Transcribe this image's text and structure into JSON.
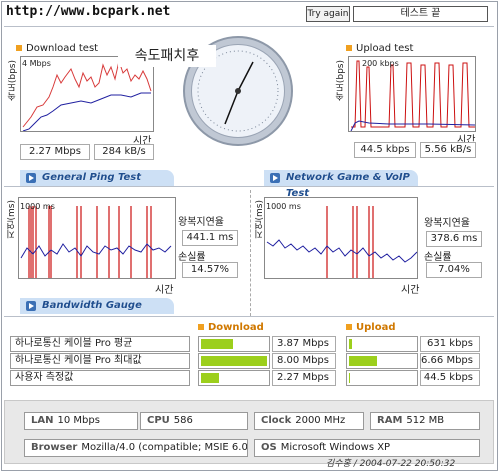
{
  "header": {
    "url": "http://www.bcpark.net",
    "try_again": "Try again",
    "test_end": "테스트 끝"
  },
  "download": {
    "title": "Download test",
    "ylabel": "속도(bps)",
    "ymax": "4 Mbps",
    "xlabel": "시간",
    "speed": "2.27 Mbps",
    "rate": "284 kB/s"
  },
  "upload": {
    "title": "Upload test",
    "ylabel": "속도(bps)",
    "ymax": "200 kbps",
    "xlabel": "시간",
    "speed": "44.5 kbps",
    "rate": "5.56 kB/s"
  },
  "gauge": {
    "label": "속도패치후",
    "needle_fraction": 0.02
  },
  "tabs": {
    "ping": "General Ping Test",
    "game": "Network Game & VoIP Test",
    "bandwidth": "Bandwidth Gauge"
  },
  "ping_left": {
    "ylabel": "지연(ms)",
    "ymax": "1000 ms",
    "xlabel": "시간",
    "rtt_label": "왕복지연율",
    "rtt": "441.1 ms",
    "loss_label": "손실률",
    "loss": "14.57%"
  },
  "ping_right": {
    "ylabel": "지연(ms)",
    "ymax": "1000 ms",
    "xlabel": "시간",
    "rtt_label": "왕복지연율",
    "rtt": "378.6 ms",
    "loss_label": "손실률",
    "loss": "7.04%"
  },
  "bandwidth": {
    "download_label": "Download",
    "upload_label": "Upload",
    "rows": [
      {
        "name": "하나로통신 케이블 Pro 평균",
        "dl_value": "3.87 Mbps",
        "dl_fraction": 0.48,
        "ul_value": "631 kbps",
        "ul_fraction": 0.04
      },
      {
        "name": "하나로통신 케이블 Pro 최대값",
        "dl_value": "8.00 Mbps",
        "dl_fraction": 1.0,
        "ul_value": "6.66 Mbps",
        "ul_fraction": 0.42
      },
      {
        "name": "사용자 측정값",
        "dl_value": "2.27 Mbps",
        "dl_fraction": 0.28,
        "ul_value": "44.5 kbps",
        "ul_fraction": 0.01
      }
    ]
  },
  "system": {
    "lan_label": "LAN",
    "lan": "10 Mbps",
    "cpu_label": "CPU",
    "cpu": "586",
    "clock_label": "Clock",
    "clock": "2000 MHz",
    "ram_label": "RAM",
    "ram": "512 MB",
    "browser_label": "Browser",
    "browser": "Mozilla/4.0 (compatible; MSIE 6.0",
    "os_label": "OS",
    "os": "Microsoft Windows XP"
  },
  "footer": {
    "signature": "김수홍 / 2004-07-22 20:50:32"
  },
  "colors": {
    "plot_line": "#2020a0",
    "loss_bar": "#cc1010",
    "bar_fill": "#9ccf1c",
    "tab_bg": "#cde0f5",
    "accent": "#f0a020"
  }
}
